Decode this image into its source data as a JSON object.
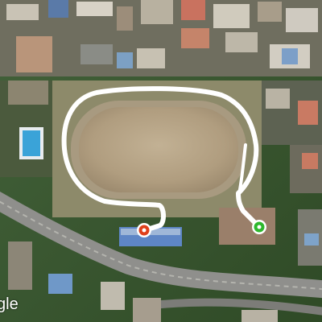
{
  "map": {
    "attribution": "gle",
    "colors": {
      "route": "#ffffff",
      "start_marker": "#2db82d",
      "end_marker": "#e0401b",
      "field": "#b9a789",
      "vegetation": "#3b5a2a",
      "road": "#8f8f8c"
    },
    "markers": [
      {
        "type": "start",
        "icon": "green-circle-marker"
      },
      {
        "type": "end",
        "icon": "red-circle-marker"
      }
    ]
  }
}
